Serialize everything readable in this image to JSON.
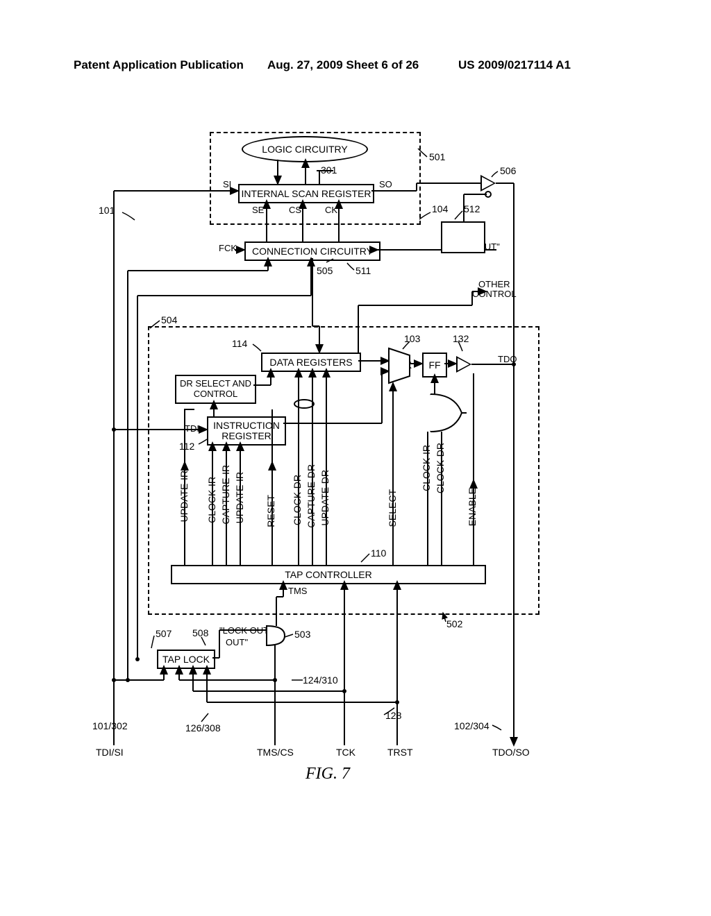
{
  "header": {
    "left": "Patent Application Publication",
    "center": "Aug. 27, 2009  Sheet 6 of 26",
    "right": "US 2009/0217114 A1"
  },
  "figure_caption": "FIG. 7",
  "blocks": {
    "logic_circuitry": "LOGIC CIRCUITRY",
    "internal_scan_register": "INTERNAL SCAN REGISTER",
    "connection_circuitry": "CONNECTION CIRCUITRY",
    "data_registers": "DATA REGISTERS",
    "dr_select": "DR SELECT AND CONTROL",
    "instruction_register_l1": "INSTRUCTION",
    "instruction_register_l2": "REGISTER",
    "tap_controller": "TAP CONTROLLER",
    "tap_lock": "TAP LOCK",
    "mux": "MUX",
    "ff": "FF",
    "or": "OR",
    "and_gate": "A"
  },
  "pins": {
    "si": "SI",
    "so": "SO",
    "se": "SE",
    "cs": "CS",
    "ck": "CK",
    "fck": "FCK",
    "o": "O",
    "lock_out": "\"LOCK OUT\"",
    "other_control_l1": "OTHER",
    "other_control_l2": "CONTROL",
    "tdi": "TDI",
    "tdo": "TDO",
    "tms": "TMS",
    "tdi_si": "TDI/SI",
    "tms_cs": "TMS/CS",
    "tck": "TCK",
    "trst": "TRST",
    "tdo_so": "TDO/SO"
  },
  "tap_signals": {
    "update_ir": "UPDATE-IR",
    "clock_ir": "CLOCK-IR",
    "capture_ir": "CAPTURE-IR",
    "update_ir2": "UPDATE-IR",
    "reset": "RESET",
    "clock_dr": "CLOCK-DR",
    "capture_dr": "CAPTURE-DR",
    "update_dr": "UPDATE-DR",
    "select": "SELECT",
    "clock_ir2": "CLOCK-IR",
    "clock_dr2": "CLOCK-DR",
    "enable": "ENABLE"
  },
  "refs": {
    "r101": "101",
    "r104": "104",
    "r301": "301",
    "r501": "501",
    "r506": "506",
    "r512": "512",
    "r505": "505",
    "r511": "511",
    "r504": "504",
    "r114": "114",
    "r112": "112",
    "r103": "103",
    "r132": "132",
    "r110": "110",
    "r502": "502",
    "r503": "503",
    "r507": "507",
    "r508": "508",
    "r128": "128",
    "r101_302": "101/302",
    "r126_308": "126/308",
    "r124_310": "124/310",
    "r102_304": "102/304"
  }
}
